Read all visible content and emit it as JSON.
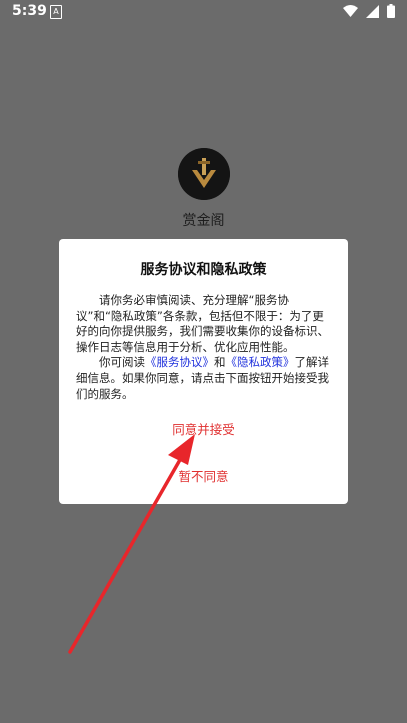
{
  "status_bar": {
    "time": "5:39",
    "notification_icon": "a-notification-icon",
    "icons": [
      "wifi-icon",
      "signal-icon",
      "battery-icon"
    ]
  },
  "app": {
    "name": "赏金阁",
    "logo_icon": "app-logo-icon"
  },
  "dialog": {
    "title": "服务协议和隐私政策",
    "paragraph1": "请你务必审慎阅读、充分理解“服务协议”和“隐私政策”各条款，包括但不限于：为了更好的向你提供服务，我们需要收集你的设备标识、操作日志等信息用于分析、优化应用性能。",
    "paragraph2_prefix": "你可阅读",
    "service_link": "《服务协议》",
    "paragraph2_and": "和",
    "privacy_link": "《隐私政策》",
    "paragraph2_suffix": "了解详细信息。如果你同意，请点击下面按钮开始接受我们的服务。",
    "agree_label": "同意并接受",
    "disagree_label": "暂不同意"
  },
  "colors": {
    "overlay": "#6b6b6b",
    "link": "#2233dd",
    "button": "#e03030",
    "arrow": "#e8262b"
  }
}
